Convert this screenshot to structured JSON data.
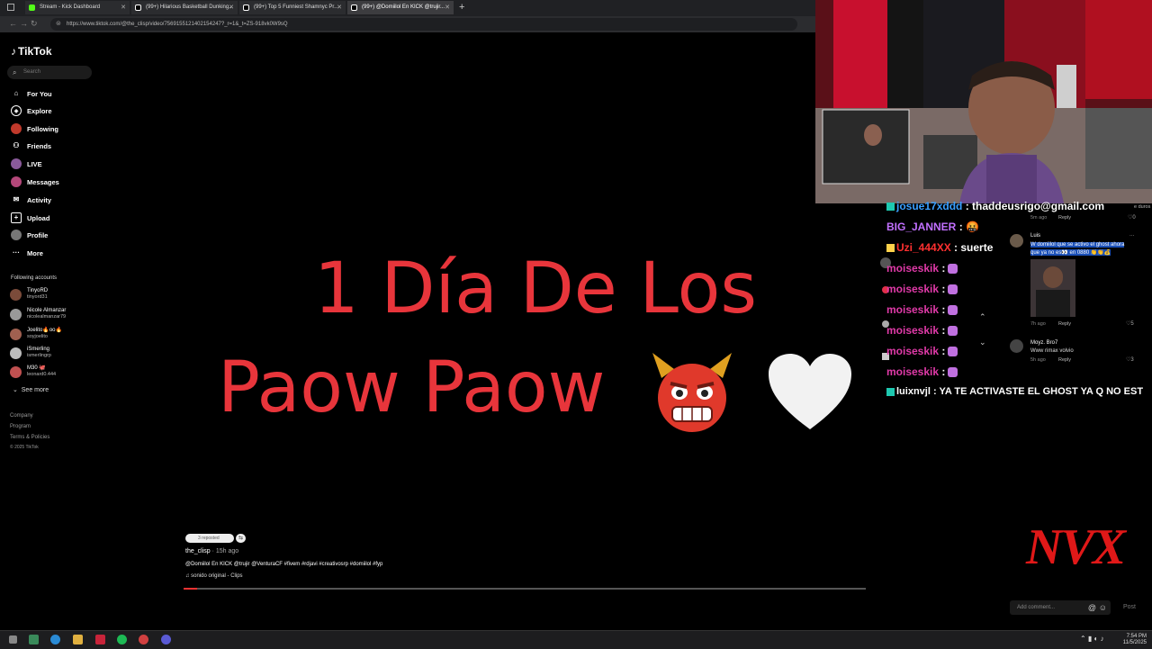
{
  "tabs": [
    {
      "title": "Stream - Kick Dashboard",
      "favicon_color": "#53fc18"
    },
    {
      "title": "(99+) Hilarious Basketball Dunking...",
      "favicon_color": "#ffffff"
    },
    {
      "title": "(99+) Top 5 Funniest Shamnyc Pr...",
      "favicon_color": "#ffffff"
    },
    {
      "title": "(99+) @Domiilol En KICK @trujir...",
      "favicon_color": "#ffffff"
    }
  ],
  "new_tab": "+",
  "address": {
    "url": "https://www.tiktok.com/@the_clisp/video/7569155121402154247?_r=1&_t=ZS-918vk0W9sQ"
  },
  "sidebar": {
    "logo": "TikTok",
    "search_placeholder": "Search",
    "nav": [
      {
        "label": "For You",
        "icon": "home-icon"
      },
      {
        "label": "Explore",
        "icon": "compass-icon"
      },
      {
        "label": "Following",
        "icon": "following-avatar-icon"
      },
      {
        "label": "Friends",
        "icon": "friends-icon"
      },
      {
        "label": "LIVE",
        "icon": "live-icon"
      },
      {
        "label": "Messages",
        "icon": "messages-icon"
      },
      {
        "label": "Activity",
        "icon": "activity-icon"
      },
      {
        "label": "Upload",
        "icon": "upload-icon"
      },
      {
        "label": "Profile",
        "icon": "profile-icon"
      },
      {
        "label": "More",
        "icon": "more-icon"
      }
    ],
    "following_title": "Following accounts",
    "accounts": [
      {
        "name": "TinyoRD",
        "handle": "tinyord31"
      },
      {
        "name": "Nicole Almanzar",
        "handle": "nicolealmanzar79"
      },
      {
        "name": "Joelito🔥oo🔥",
        "handle": "soyjoelito"
      },
      {
        "name": "iSmerling",
        "handle": "ismerlingrp"
      },
      {
        "name": "M30 🐙",
        "handle": "leonard0.444"
      }
    ],
    "see_more": "See more",
    "footer": [
      "Company",
      "Program",
      "Terms & Policies",
      "© 2025 TikTok"
    ]
  },
  "video": {
    "line1": "1 Día De Los",
    "line2": "Paow Paow",
    "repost_text": "3 reposted",
    "author": "the_clisp",
    "ago": "· 15h ago",
    "caption": "@Domiilol En KICK @trujir @VenturaCF #fivem #rdjavi #creativosrp #domiilol #fyp",
    "sound": "♫ sonido original - Clips",
    "progress_fraction": 0.02
  },
  "chat": [
    {
      "user": "josue17xddd",
      "color": "#3aa0ff",
      "text": ": thaddeusrigo@gmail.com",
      "badge": true
    },
    {
      "user": "BIG_JANNER",
      "color": "#c270ff",
      "text": ": 🤬",
      "badge": false
    },
    {
      "user": "Uzi_444XX",
      "color": "#ff3030",
      "text": ": suerte",
      "badge": true
    },
    {
      "user": "moiseskik",
      "color": "#e03aa8",
      "text": ":",
      "badge": false
    },
    {
      "user": "moiseskik",
      "color": "#e03aa8",
      "text": ":",
      "badge": false
    },
    {
      "user": "moiseskik",
      "color": "#e03aa8",
      "text": ":",
      "badge": false
    },
    {
      "user": "moiseskik",
      "color": "#e03aa8",
      "text": ":",
      "badge": false
    },
    {
      "user": "moiseskik",
      "color": "#e03aa8",
      "text": ":",
      "badge": false
    },
    {
      "user": "moiseskik",
      "color": "#e03aa8",
      "text": ":",
      "badge": false
    },
    {
      "user": "luixnvjl",
      "color": "#ffffff",
      "text": ": YA TE ACTIVASTE EL GHOST YA Q NO EST",
      "badge": true
    }
  ],
  "comments": {
    "top_meta": "5m ago",
    "top_reply": "Reply",
    "top_like": "0",
    "top_snippet": "e duros",
    "c1_user": "Luis",
    "c1_text1": "W domiilol que se activo el ghost ahora",
    "c1_text2": "que ya no es👀 en 0880 👏👏💰",
    "c1_meta": "7h ago",
    "c1_reply": "Reply",
    "c1_like": "5",
    "c2_user": "Moyz. Bro7",
    "c2_text": "Www rimax volvio",
    "c2_meta": "5h ago",
    "c2_reply": "Reply",
    "c2_like": "3",
    "add_placeholder": "Add comment...",
    "post": "Post"
  },
  "overlay_logo": "NVX",
  "taskbar": {
    "time": "7:54 PM",
    "date": "11/5/2025"
  }
}
